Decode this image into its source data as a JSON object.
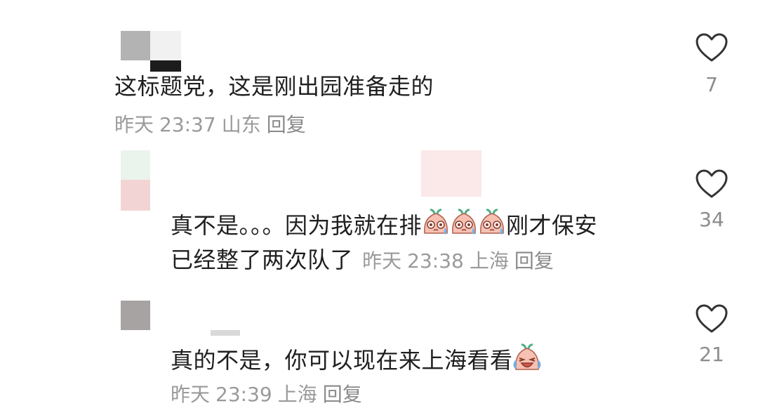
{
  "comments": [
    {
      "text": "这标题党，这是刚出园准备走的",
      "date": "昨天",
      "time": "23:37",
      "location": "山东",
      "reply_label": "回复",
      "likes": "7"
    },
    {
      "text_line1_a": "真不是。。。因为我就在排",
      "text_line1_b": "刚才保安",
      "text_line2": "已经整了两次队了",
      "date": "昨天",
      "time": "23:38",
      "location": "上海",
      "reply_label": "回复",
      "likes": "34",
      "emoji_name": "sweat-face-emoji"
    },
    {
      "text": "真的不是，你可以现在来上海看看",
      "date": "昨天",
      "time": "23:39",
      "location": "上海",
      "reply_label": "回复",
      "likes": "21",
      "emoji_name": "laugh-cry-emoji"
    }
  ],
  "colors": {
    "text": "#1f1f1f",
    "meta": "#9a9a9a",
    "heart_stroke": "#333333",
    "emoji_fill": "#f6c1b2"
  }
}
